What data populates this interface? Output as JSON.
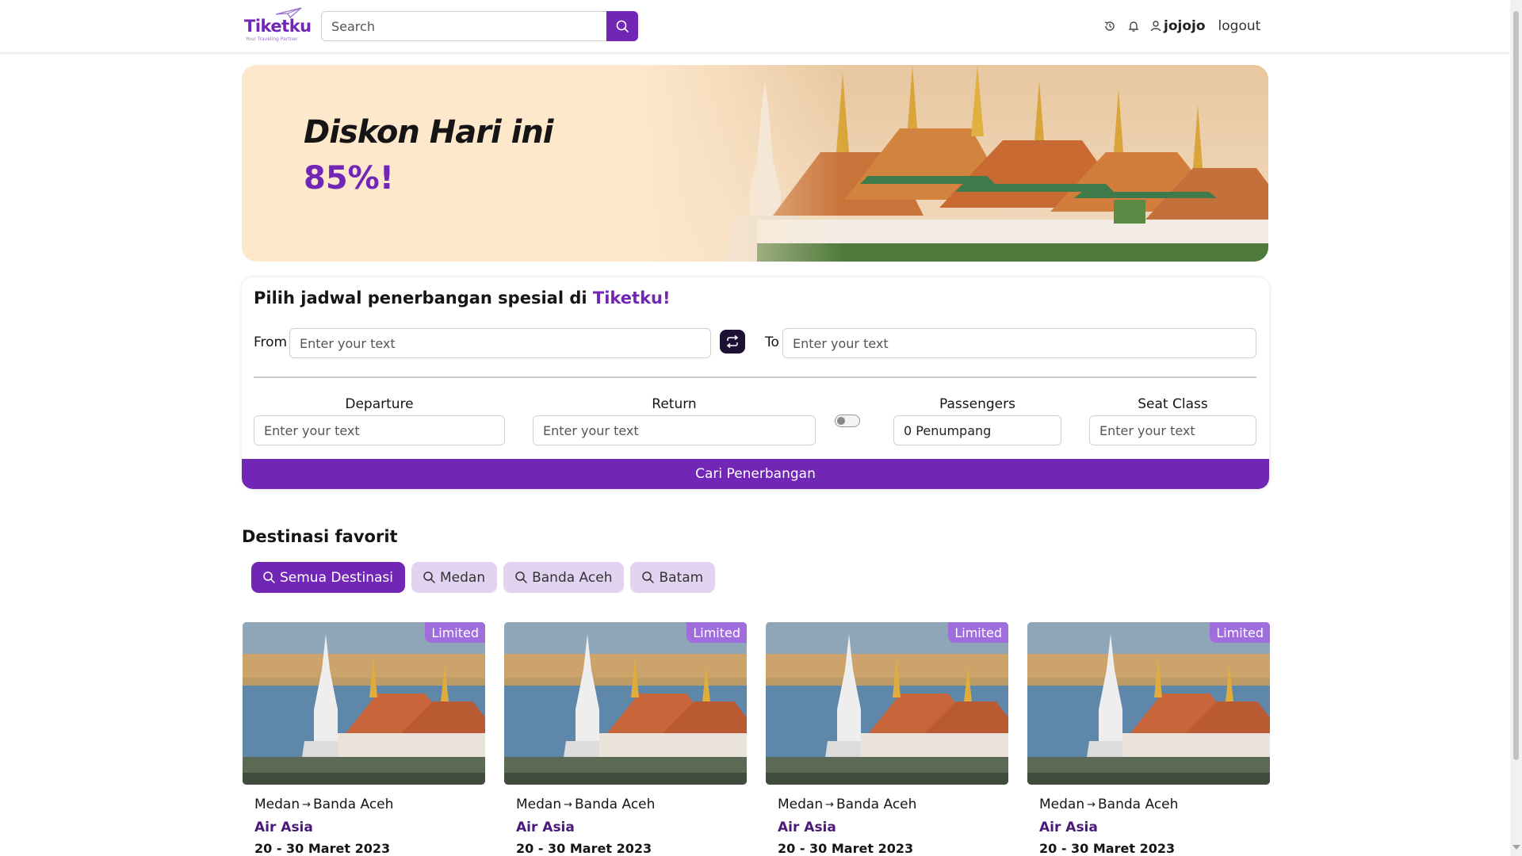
{
  "header": {
    "logo_text": "Tiketku",
    "logo_tagline": "Your Traveling Partner",
    "search_placeholder": "Search",
    "username": "jojojo",
    "logout_label": "logout",
    "icons": [
      "search-icon",
      "history-icon",
      "bell-icon",
      "user-icon"
    ]
  },
  "banner": {
    "title": "Diskon Hari ini",
    "discount": "85%!"
  },
  "flight_search": {
    "title_prefix": "Pilih jadwal penerbangan spesial di ",
    "title_brand": "Tiketku!",
    "from_label": "From",
    "from_placeholder": "Enter your text",
    "to_label": "To",
    "to_placeholder": "Enter your text",
    "departure_label": "Departure",
    "departure_placeholder": "Enter your text",
    "return_label": "Return",
    "return_placeholder": "Enter your text",
    "return_toggle_on": false,
    "passengers_label": "Passengers",
    "passengers_value": "0 Penumpang",
    "seat_class_label": "Seat Class",
    "seat_class_placeholder": "Enter your text",
    "submit_label": "Cari Penerbangan"
  },
  "favorites": {
    "title": "Destinasi favorit",
    "chips": [
      {
        "label": "Semua Destinasi",
        "active": true
      },
      {
        "label": "Medan",
        "active": false
      },
      {
        "label": "Banda Aceh",
        "active": false
      },
      {
        "label": "Batam",
        "active": false
      }
    ],
    "cards": [
      {
        "badge": "Limited",
        "from": "Medan",
        "to": "Banda Aceh",
        "airline": "Air Asia",
        "dates": "20 - 30 Maret 2023"
      },
      {
        "badge": "Limited",
        "from": "Medan",
        "to": "Banda Aceh",
        "airline": "Air Asia",
        "dates": "20 - 30 Maret 2023"
      },
      {
        "badge": "Limited",
        "from": "Medan",
        "to": "Banda Aceh",
        "airline": "Air Asia",
        "dates": "20 - 30 Maret 2023"
      },
      {
        "badge": "Limited",
        "from": "Medan",
        "to": "Banda Aceh",
        "airline": "Air Asia",
        "dates": "20 - 30 Maret 2023"
      }
    ]
  },
  "colors": {
    "brand": "#7126b5",
    "chip_bg": "#e2d4f0",
    "banner_bg": "#fde8cc",
    "badge_bg": "#a06ddd"
  }
}
